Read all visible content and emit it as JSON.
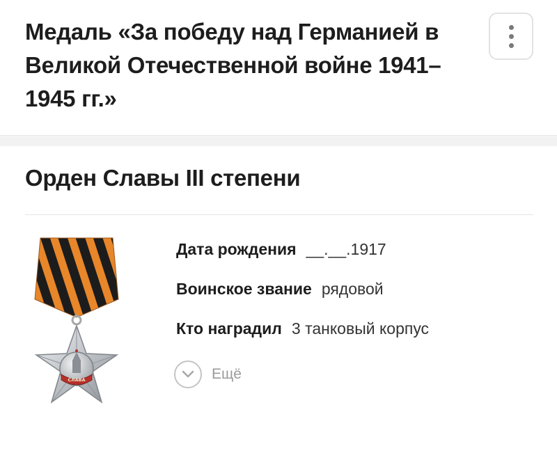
{
  "header": {
    "title": "Медаль «За победу над Германией в Великой Отечественной войне 1941–1945 гг.»",
    "menu_icon": "vertical-dots-icon"
  },
  "award": {
    "title": "Орден Славы III степени",
    "image_icon": "order-of-glory-medal-icon",
    "medal_inscription": "СЛАВА",
    "fields": [
      {
        "label": "Дата рождения",
        "value": "__.__.1917"
      },
      {
        "label": "Воинское звание",
        "value": "рядовой"
      },
      {
        "label": "Кто наградил",
        "value": "3 танковый корпус"
      }
    ],
    "more_label": "Ещё",
    "more_icon": "chevron-down-circle-icon"
  },
  "colors": {
    "ribbon_orange": "#e8862a",
    "ribbon_black": "#1c1c1c",
    "star_silver": "#c9ccd0",
    "text_dark": "#1d1d1d"
  }
}
